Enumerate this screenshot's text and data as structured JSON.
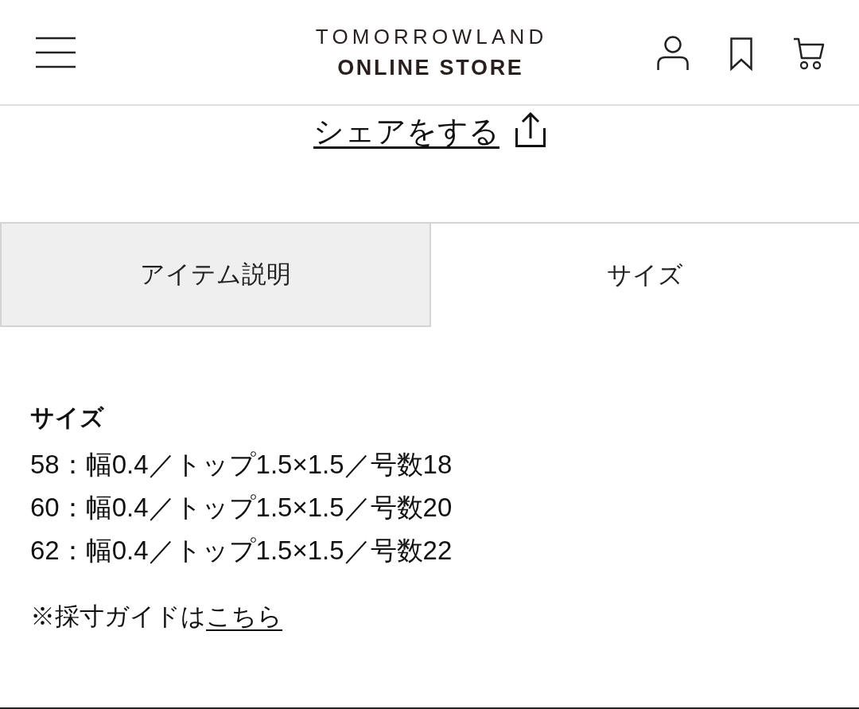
{
  "header": {
    "logo_line_1": "TOMORROWLAND",
    "logo_line_2": "ONLINE STORE"
  },
  "share": {
    "label": "シェアをする"
  },
  "tabs": [
    {
      "label": "アイテム説明",
      "selected": false
    },
    {
      "label": "サイズ",
      "selected": true
    }
  ],
  "size_section": {
    "heading": "サイズ",
    "rows": [
      "58：幅0.4／トップ1.5×1.5／号数18",
      "60：幅0.4／トップ1.5×1.5／号数20",
      "62：幅0.4／トップ1.5×1.5／号数22"
    ],
    "note": {
      "text": "※採寸ガイドは",
      "link": "こちら"
    }
  }
}
